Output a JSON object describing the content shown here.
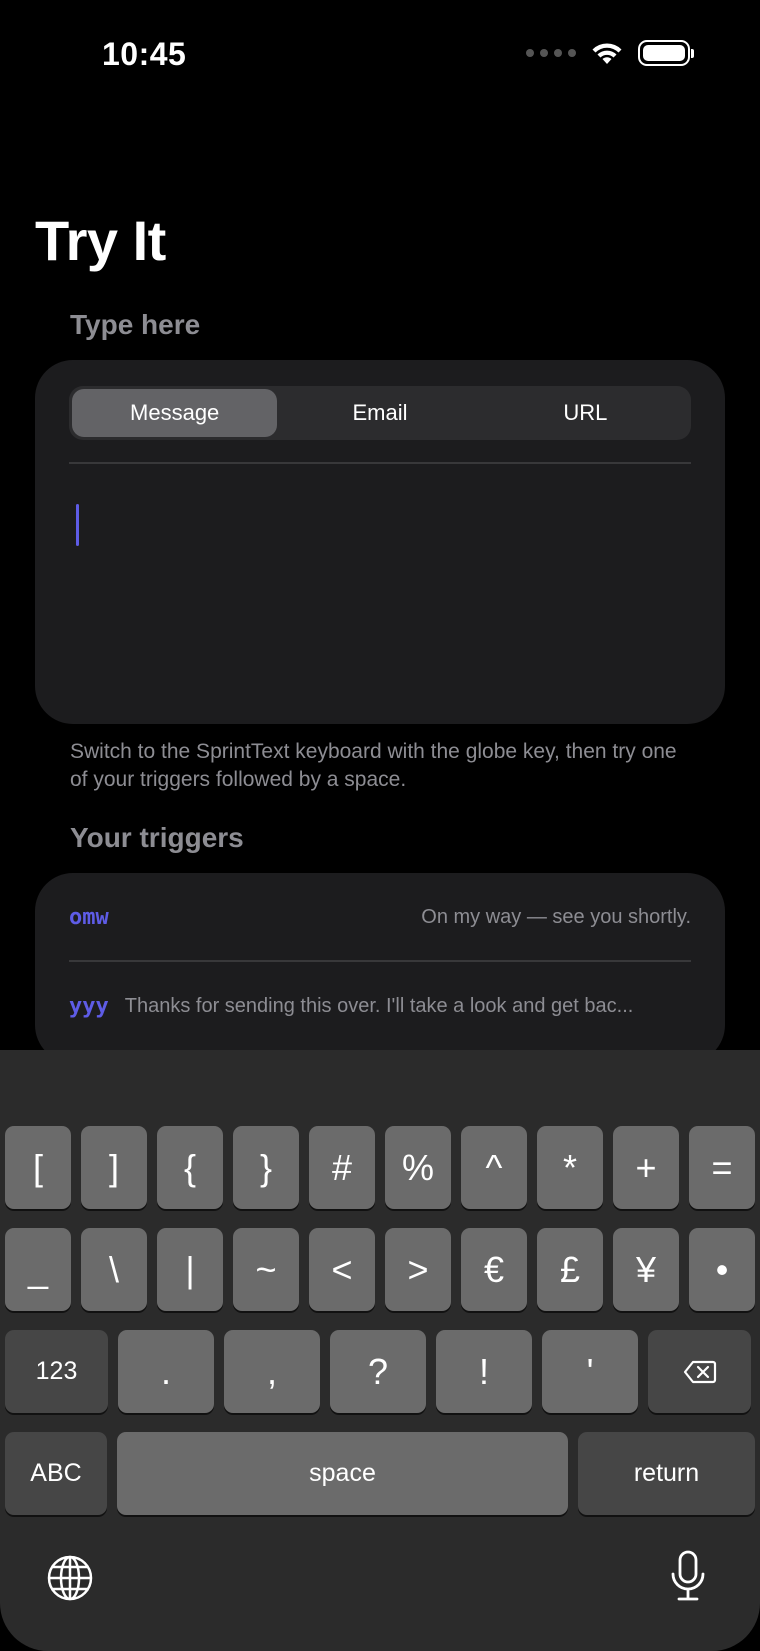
{
  "status": {
    "time": "10:45"
  },
  "page": {
    "title": "Try It"
  },
  "type_here": {
    "header": "Type here",
    "segments": [
      "Message",
      "Email",
      "URL"
    ],
    "selected_segment": "Message"
  },
  "note": "Switch to the SprintText keyboard with the globe key, then try one of your triggers followed by a space.",
  "triggers": {
    "header": "Your triggers",
    "items": [
      {
        "key": "omw",
        "value": "On my way — see you shortly."
      },
      {
        "key": "yyy",
        "value": "Thanks for sending this over. I'll take a look and get bac..."
      }
    ]
  },
  "keyboard": {
    "row1": [
      "[",
      "]",
      "{",
      "}",
      "#",
      "%",
      "^",
      "*",
      "+",
      "="
    ],
    "row2": [
      "_",
      "\\",
      "|",
      "~",
      "<",
      ">",
      "€",
      "£",
      "¥",
      "•"
    ],
    "row3": {
      "mode_key": "123",
      "keys": [
        ".",
        ",",
        "?",
        "!",
        "'"
      ]
    },
    "row4": {
      "abc_key": "ABC",
      "space_key": "space",
      "return_key": "return"
    }
  },
  "colors": {
    "accent": "#5e5ce6",
    "card": "#1c1c1e",
    "key": "#6b6b6b",
    "key_dark": "#464646"
  }
}
